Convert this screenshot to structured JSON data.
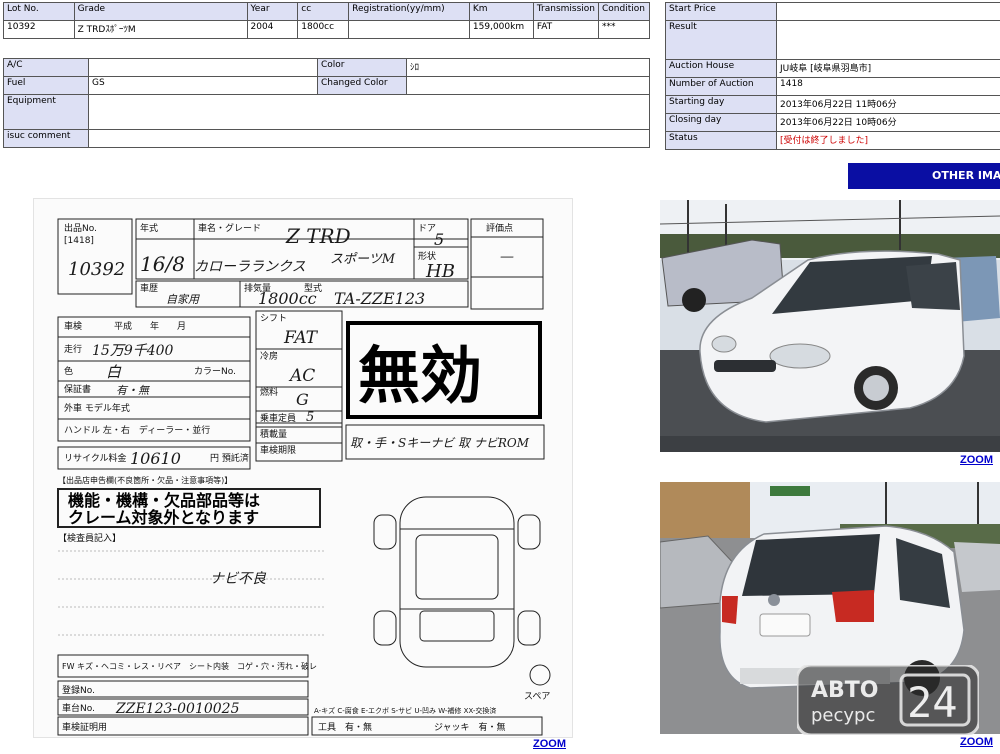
{
  "lot_table": {
    "headers": [
      "Lot No.",
      "Grade",
      "Year",
      "cc",
      "Registration(yy/mm)",
      "Km",
      "Transmission",
      "Condition"
    ],
    "values": [
      "10392",
      "Z TRDｽﾎﾟｰﾂM",
      "2004",
      "1800cc",
      "",
      "159,000km",
      "FAT",
      "***"
    ]
  },
  "details_table": {
    "ac_label": "A/C",
    "ac_value": "",
    "color_label": "Color",
    "color_value": "ｼﾛ",
    "fuel_label": "Fuel",
    "fuel_value": "GS",
    "changed_color_label": "Changed Color",
    "changed_color_value": "",
    "equipment_label": "Equipment",
    "equipment_value": "",
    "comment_label": "isuc comment",
    "comment_value": ""
  },
  "auction_table": {
    "start_price_label": "Start Price",
    "start_price_value": "",
    "result_label": "Result",
    "result_value": "",
    "auction_house_label": "Auction House",
    "auction_house_value": "JU岐阜 [岐阜県羽島市]",
    "number_label": "Number of Auction",
    "number_value": "1418",
    "starting_label": "Starting day",
    "starting_value": "2013年06月22日 11時06分",
    "closing_label": "Closing day",
    "closing_value": "2013年06月22日 10時06分",
    "status_label": "Status",
    "status_value": "[受付は終了しました]"
  },
  "other_images_button": "OTHER IMAGES",
  "auction_sheet": {
    "lot_no_label": "出品No.",
    "auction_no": "[1418]",
    "lot_no": "10392",
    "year_label": "年式",
    "grade_label": "車名・グレード",
    "door_label": "ドア",
    "grade_text": "Z TRD",
    "grade_text2": "スポーツM",
    "door_value": "5",
    "shape_label": "形状",
    "shape_value": "HB",
    "year_value": "16/8",
    "car_name": "カローラランクス",
    "score_label": "評価点",
    "score_value": "—",
    "purpose_label": "車歴",
    "purpose_value": "自家用",
    "displacement_label": "排気量",
    "displacement_value": "1800cc",
    "model_label": "型式",
    "model_value": "TA-ZZE123",
    "shaken_label": "車検",
    "shaken_value": "平成　　年　　月",
    "mileage_label": "走行",
    "mileage_value": "15万9千400",
    "color_label": "色",
    "color_value": "白",
    "color_no_label": "カラーNo.",
    "shift_label": "シフト",
    "shift_value": "FAT",
    "ac_label": "冷房",
    "ac_value": "AC",
    "fuel_label": "燃料",
    "fuel_value": "G",
    "warranty_label": "保証書",
    "warranty_value": "有・無",
    "model_year_label": "外車 モデル年式",
    "handle_label": "ハンドル 左・右　ディーラー・並行",
    "capacity_label": "乗車定員",
    "capacity_value": "5",
    "load_label": "積載量",
    "ext_label": "車検期限",
    "recycle_label": "リサイクル料金",
    "recycle_value": "10610",
    "recycle_unit": "円 預託済",
    "seller_notes_label": "【出品店申告欄(不良箇所・欠品・注意事項等)】",
    "box_line1": "機能・機構・欠品部品等は",
    "box_line2": "クレーム対象外となります",
    "inspector_label": "【検査員記入】",
    "inspector_note": "ナビ不良",
    "equipment_note": "取・手・Sキーナビ 取 ナビROM",
    "invalid_stamp": "無効",
    "fw_row": "FW キズ・ヘコミ・レス・リペア　シート内装　コゲ・穴・汚れ・破レ",
    "registration_label": "登録No.",
    "chassis_label": "車台No.",
    "chassis_value": "ZZE123-0010025",
    "cert_label": "車検証明用",
    "tools_label": "工具　有・無",
    "jack_label": "ジャッキ　有・無",
    "spare_label": "スペア",
    "legend": "A-キズ C-腐食 E-エクボ S-サビ U-凹み W-補修 XX-交換済"
  },
  "zoom_links": [
    "ZOOM",
    "ZOOM",
    "ZOOM"
  ],
  "watermark": {
    "line1": "АВТО",
    "line2": "ресурс",
    "number": "24"
  },
  "colors": {
    "header_bg": "#dde0f4",
    "button_bg": "#0a0ea3",
    "status_red": "#cc0000",
    "link": "#0000cc"
  }
}
